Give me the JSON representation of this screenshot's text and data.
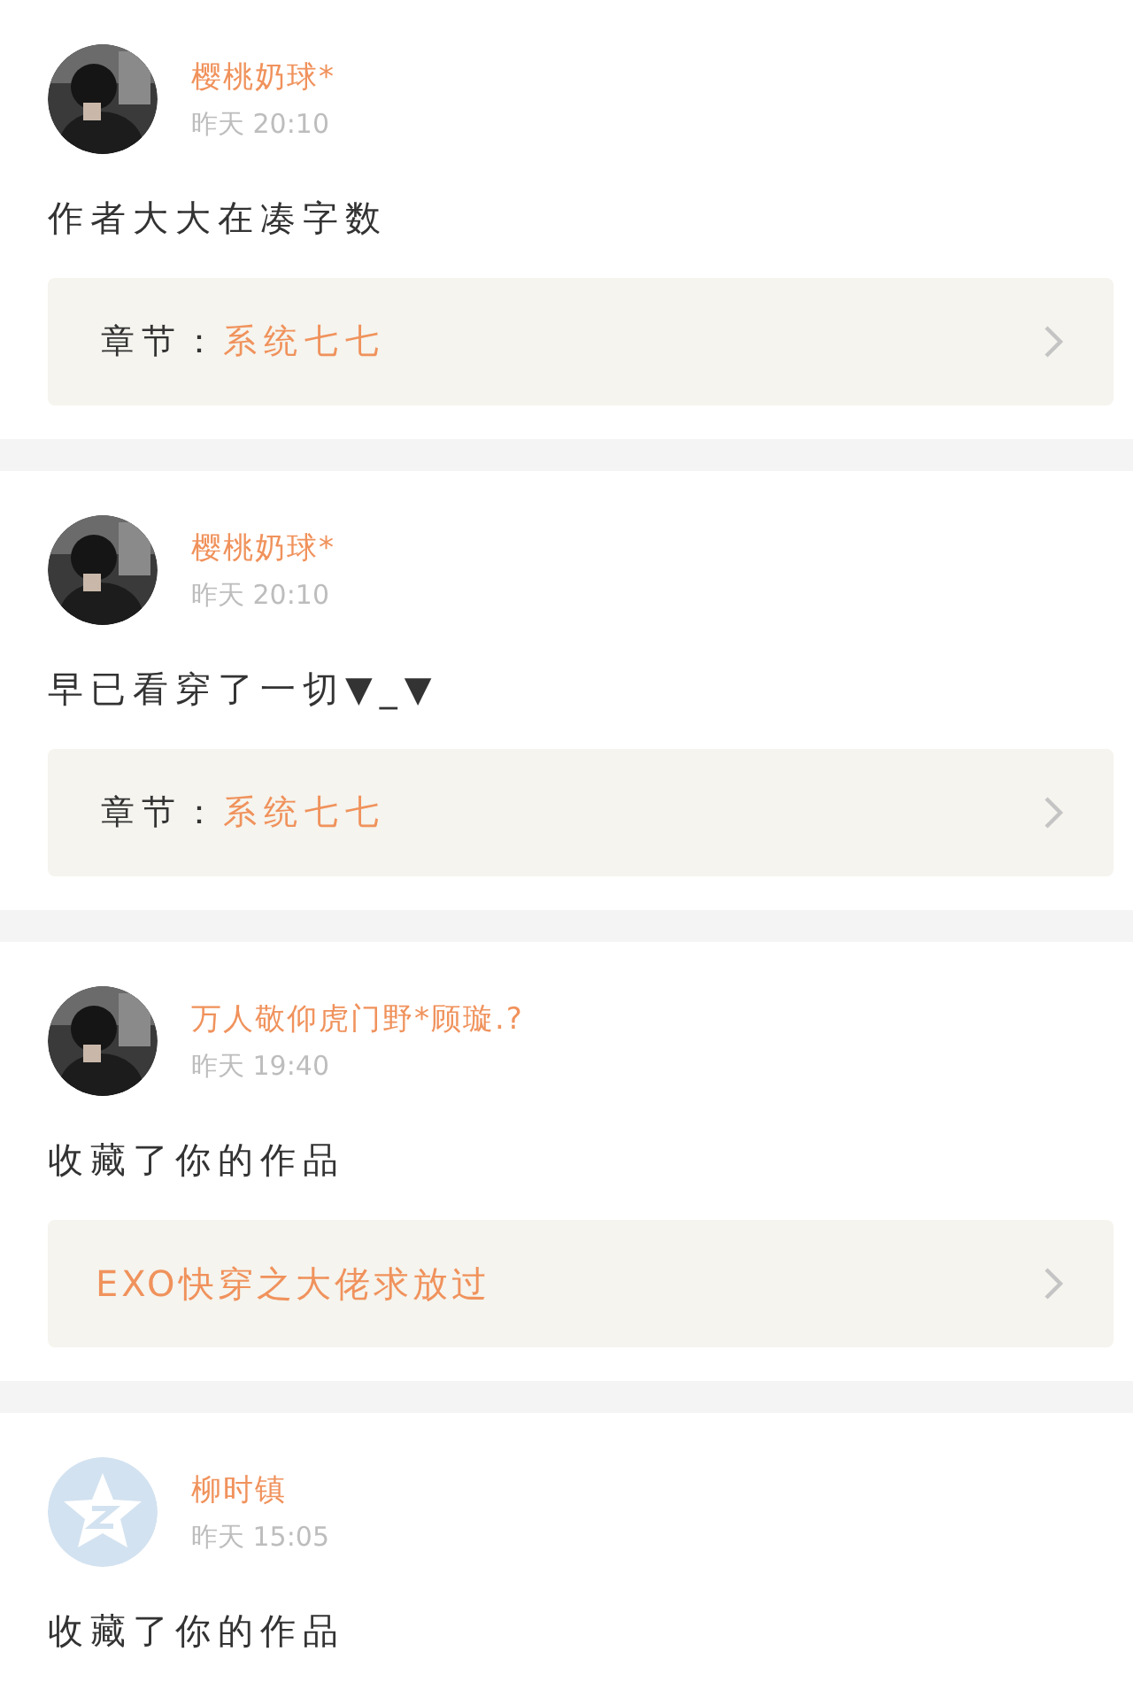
{
  "notifications": [
    {
      "user": "樱桃奶球*",
      "time": "昨天 20:10",
      "text": "作者大大在凑字数",
      "link": {
        "kind": "chapter",
        "label": "章节：",
        "title": "系统七七"
      }
    },
    {
      "user": "樱桃奶球*",
      "time": "昨天 20:10",
      "text": "早已看穿了一切▼_▼",
      "link": {
        "kind": "chapter",
        "label": "章节：",
        "title": "系统七七"
      }
    },
    {
      "user": "万人敬仰虎门野*顾璇.?",
      "time": "昨天 19:40",
      "text": "收藏了你的作品",
      "link": {
        "kind": "work",
        "title": "EXO快穿之大佬求放过"
      }
    },
    {
      "avatar": {
        "kind": "default"
      },
      "user": "柳时镇",
      "time": "昨天 15:05",
      "text": "收藏了你的作品"
    }
  ]
}
